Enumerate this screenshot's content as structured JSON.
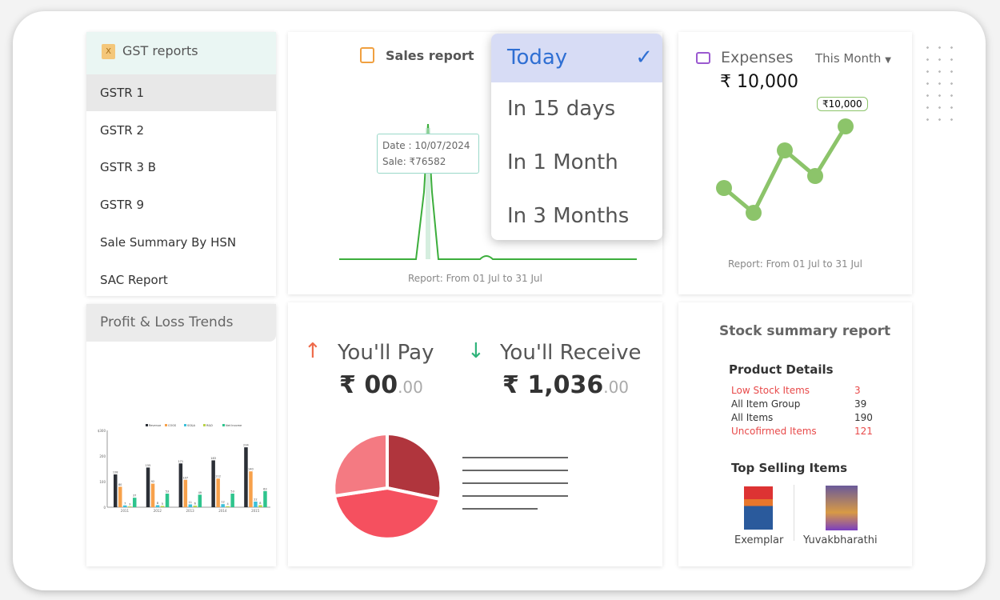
{
  "gst": {
    "title": "GST reports",
    "items": [
      "GSTR 1",
      "GSTR 2",
      "GSTR 3 B",
      "GSTR 9",
      "Sale Summary By HSN",
      "SAC Report"
    ]
  },
  "pl": {
    "title": "Profit & Loss Trends"
  },
  "sales": {
    "title": "Sales report",
    "tooltip_date": "Date : 10/07/2024",
    "tooltip_sale": "Sale: ₹76582",
    "footer": "Report: From 01 Jul to 31 Jul"
  },
  "dropdown": {
    "items": [
      "Today",
      "In 15 days",
      "In 1 Month",
      "In 3 Months"
    ],
    "selected": "Today"
  },
  "expenses": {
    "title": "Expenses",
    "period": "This Month",
    "amount": "₹ 10,000",
    "badge": "₹10,000",
    "footer": "Report: From 01 Jul to 31 Jul",
    "line_color": "#8cc46a"
  },
  "pay": {
    "pay_label": "You'll Pay",
    "pay_amount": "₹ 00",
    "pay_dec": ".00",
    "recv_label": "You'll Receive",
    "recv_amount": "₹ 1,036",
    "recv_dec": ".00"
  },
  "stock": {
    "title": "Stock summary report",
    "details_title": "Product Details",
    "rows": [
      {
        "label": "Low Stock Items",
        "value": "3",
        "alert": true
      },
      {
        "label": "All Item Group",
        "value": "39",
        "alert": false
      },
      {
        "label": "All Items",
        "value": "190",
        "alert": false
      },
      {
        "label": "Uncofirmed Items",
        "value": "121",
        "alert": true
      }
    ],
    "top_title": "Top Selling Items",
    "items": [
      "Exemplar",
      "Yuvakbharathi"
    ]
  },
  "chart_data": {
    "type": "bar",
    "categories": [
      "2011",
      "2012",
      "2013",
      "2014",
      "2015"
    ],
    "ylim": [
      0,
      300
    ],
    "yticks": [
      "0",
      "100",
      "200",
      "$300"
    ],
    "series": [
      {
        "name": "Revenue",
        "color": "#2b2f36",
        "values": [
          128,
          155,
          171,
          183,
          234
        ]
      },
      {
        "name": "COGS",
        "color": "#f7a14b",
        "values": [
          80,
          92,
          107,
          112,
          140
        ]
      },
      {
        "name": "SG&A",
        "color": "#3bc0d9",
        "values": [
          7,
          8,
          11,
          12,
          22
        ]
      },
      {
        "name": "R&D",
        "color": "#b9d24a",
        "values": [
          3,
          5,
          6,
          4,
          8
        ]
      },
      {
        "name": "Net Income",
        "color": "#2fc48d",
        "values": [
          37,
          53,
          49,
          53,
          63
        ]
      }
    ]
  }
}
